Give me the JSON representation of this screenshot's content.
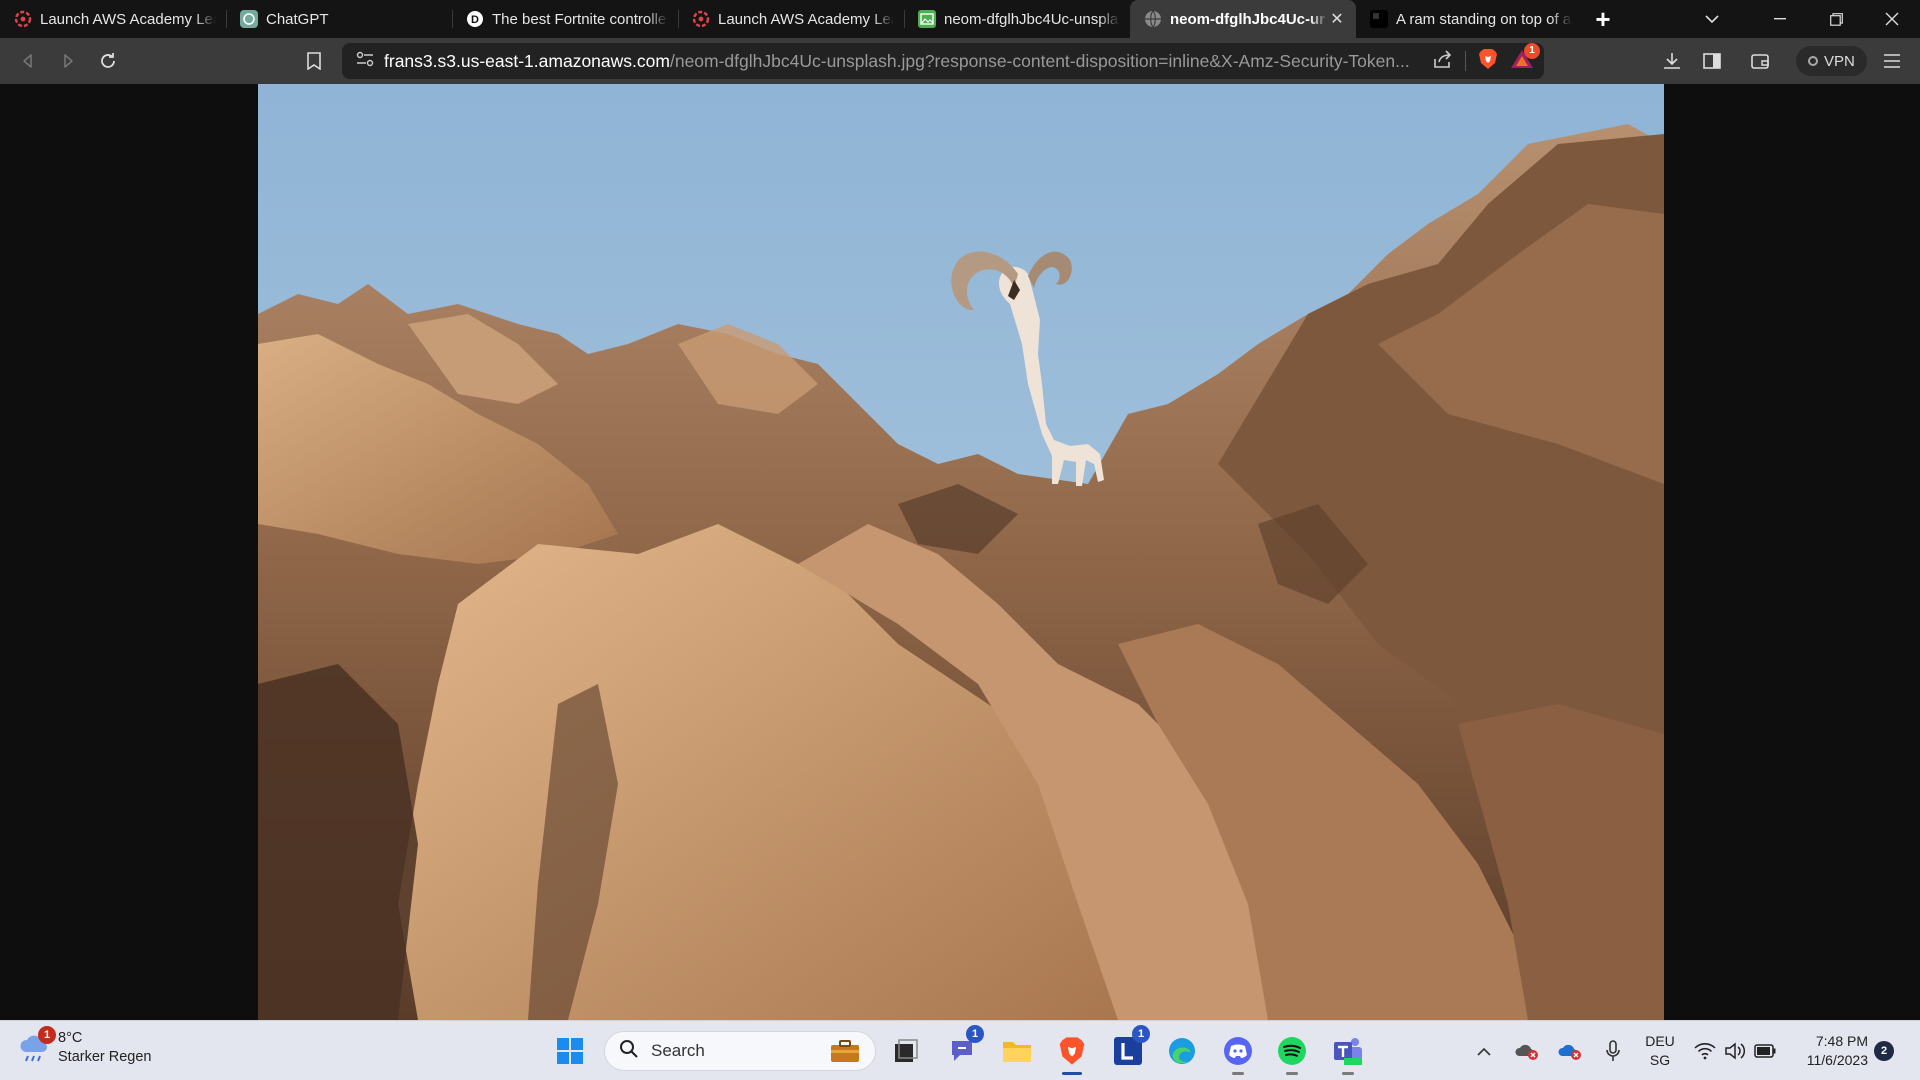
{
  "browser": {
    "tabs": [
      {
        "title": "Launch AWS Academy Lear",
        "icon": "aws-academy-icon",
        "active": false
      },
      {
        "title": "ChatGPT",
        "icon": "chatgpt-icon",
        "active": false
      },
      {
        "title": "The best Fortnite controller",
        "icon": "site-icon",
        "active": false
      },
      {
        "title": "Launch AWS Academy Lear",
        "icon": "aws-academy-icon",
        "active": false
      },
      {
        "title": "neom-dfglhJbc4Uc-unspla",
        "icon": "image-icon",
        "active": false
      },
      {
        "title": "neom-dfglhJbc4Uc-ur",
        "icon": "globe-icon",
        "active": true
      },
      {
        "title": "A ram standing on top of a",
        "icon": "black-square-icon",
        "active": false
      }
    ],
    "new_tab_label": "+",
    "url_host": "frans3.s3.us-east-1.amazonaws.com",
    "url_path": "/neom-dfglhJbc4Uc-unsplash.jpg?response-content-disposition=inline&X-Amz-Security-Token...",
    "vpn_label": "VPN",
    "shield_badge": "1"
  },
  "content": {
    "image_name": "neom-dfglhJbc4Uc-unsplash.jpg"
  },
  "taskbar": {
    "weather_temp": "8°C",
    "weather_desc": "Starker Regen",
    "weather_badge": "1",
    "search_placeholder": "Search",
    "chat_badge": "1",
    "l_app_badge": "1",
    "lang_top": "DEU",
    "lang_bottom": "SG",
    "time": "7:48 PM",
    "date": "11/6/2023",
    "notification_count": "2"
  }
}
